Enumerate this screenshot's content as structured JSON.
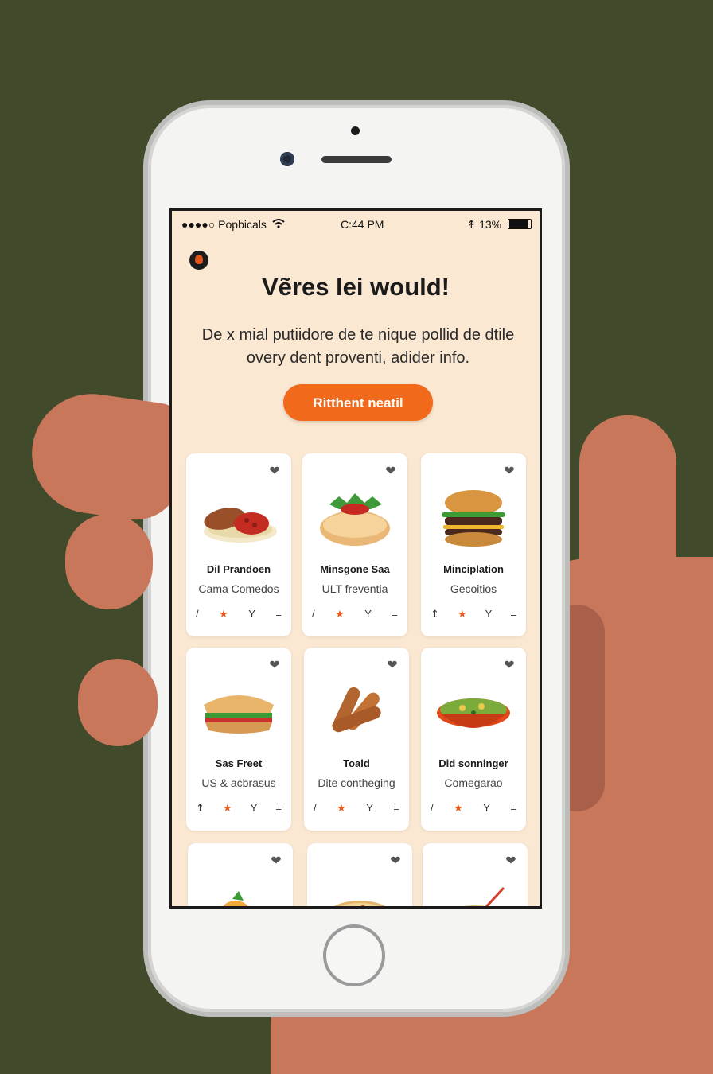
{
  "status_bar": {
    "carrier": "●●●●○ Popbicals",
    "time": "C:44 PM",
    "battery": "13%"
  },
  "title": "Vẽres lei would!",
  "description": "De x mial putiidore de te nique pollid de dtile overy dent proventi, adider info.",
  "cta_label": "Ritthent neatil",
  "cards": [
    {
      "name": "Dil Prandoen",
      "subtitle": "Cama Comedos",
      "food_icon": "roast-meat-icon",
      "icons": [
        "/",
        "★",
        "Y",
        "="
      ]
    },
    {
      "name": "Minsgone Saa",
      "subtitle": "ULT freventia",
      "food_icon": "bun-icon",
      "icons": [
        "/",
        "★",
        "Y",
        "="
      ]
    },
    {
      "name": "Minciplation",
      "subtitle": "Gecoitios",
      "food_icon": "burger-icon",
      "icons": [
        "↥",
        "★",
        "Y",
        "="
      ]
    },
    {
      "name": "Sas Freet",
      "subtitle": "US & acbrasus",
      "food_icon": "sandwich-icon",
      "icons": [
        "↥",
        "★",
        "Y",
        "="
      ]
    },
    {
      "name": "Toald",
      "subtitle": "Dite contheging",
      "food_icon": "sausage-icon",
      "icons": [
        "/",
        "★",
        "Y",
        "="
      ]
    },
    {
      "name": "Did sonninger",
      "subtitle": "Comegarao",
      "food_icon": "salad-bowl-icon",
      "icons": [
        "/",
        "★",
        "Y",
        "="
      ]
    },
    {
      "name": "",
      "subtitle": "",
      "food_icon": "fried-food-icon",
      "icons": []
    },
    {
      "name": "",
      "subtitle": "",
      "food_icon": "pizza-icon",
      "icons": []
    },
    {
      "name": "",
      "subtitle": "",
      "food_icon": "noodle-cup-icon",
      "icons": []
    }
  ],
  "colors": {
    "accent": "#f16a1c",
    "screen_bg": "#fbe8d2",
    "backdrop": "#414b2c",
    "skin": "#c8775a"
  }
}
